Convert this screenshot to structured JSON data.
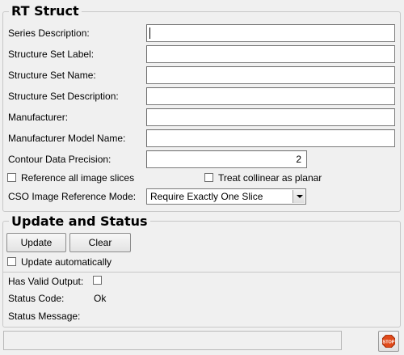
{
  "rt_struct": {
    "title": "RT Struct",
    "fields": [
      {
        "label": "Series Description:",
        "value": ""
      },
      {
        "label": "Structure Set Label:",
        "value": ""
      },
      {
        "label": "Structure Set Name:",
        "value": ""
      },
      {
        "label": "Structure Set Description:",
        "value": ""
      },
      {
        "label": "Manufacturer:",
        "value": ""
      },
      {
        "label": "Manufacturer Model Name:",
        "value": ""
      }
    ],
    "contour_precision": {
      "label": "Contour Data Precision:",
      "value": "2"
    },
    "reference_all_slices": {
      "label": "Reference all image slices",
      "checked": false
    },
    "treat_collinear": {
      "label": "Treat collinear as planar",
      "checked": false
    },
    "cso_mode": {
      "label": "CSO Image Reference Mode:",
      "selected": "Require Exactly One Slice"
    }
  },
  "update_status": {
    "title": "Update and Status",
    "update_button": "Update",
    "clear_button": "Clear",
    "update_auto": {
      "label": "Update automatically",
      "checked": false
    },
    "has_valid_output": {
      "label": "Has Valid Output:",
      "checked": false
    },
    "status_code": {
      "label": "Status Code:",
      "value": "Ok"
    },
    "status_message": {
      "label": "Status Message:",
      "value": ""
    }
  },
  "footer": {
    "status_text": "",
    "stop_icon_text": "STOP"
  },
  "colors": {
    "stop_red": "#e04a1a"
  }
}
